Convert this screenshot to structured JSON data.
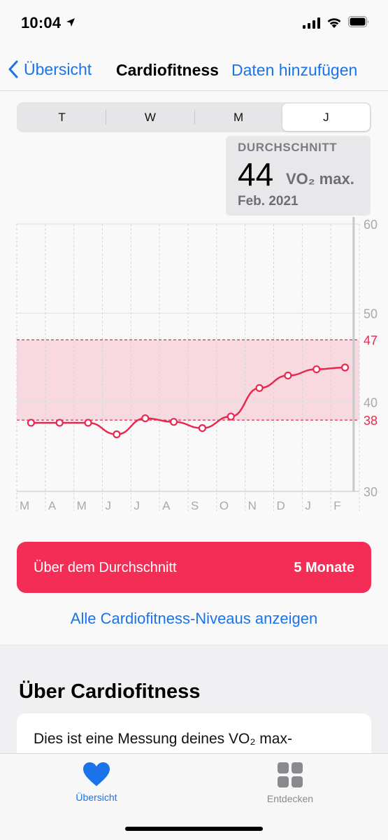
{
  "status_bar": {
    "time": "10:04"
  },
  "nav": {
    "back_label": "Übersicht",
    "title": "Cardiofitness",
    "action_label": "Daten hinzufügen"
  },
  "segments": [
    {
      "label": "T",
      "active": false
    },
    {
      "label": "W",
      "active": false
    },
    {
      "label": "M",
      "active": false
    },
    {
      "label": "J",
      "active": true
    }
  ],
  "summary": {
    "label": "DURCHSCHNITT",
    "value": "44",
    "unit": "VO₂ max.",
    "date": "Feb. 2021"
  },
  "chart_data": {
    "type": "line",
    "categories": [
      "M",
      "A",
      "M",
      "J",
      "J",
      "A",
      "S",
      "O",
      "N",
      "D",
      "J",
      "F"
    ],
    "x": [
      "Mär",
      "Apr",
      "Mai",
      "Jun",
      "Jul",
      "Aug",
      "Sep",
      "Okt",
      "Nov",
      "Dez",
      "Jan",
      "Feb"
    ],
    "series": [
      {
        "color": "#e8294f",
        "values": [
          37.7,
          37.7,
          37.7,
          36.4,
          38.2,
          37.8,
          37.1,
          38.4,
          41.6,
          43.0,
          43.7,
          43.9
        ]
      }
    ],
    "ylim": [
      30,
      60
    ],
    "yticks": [
      30,
      40,
      50,
      60
    ],
    "range_band": {
      "low": 38,
      "high": 47,
      "color": "#f7d9df"
    },
    "band_labels": [
      "47",
      "38"
    ],
    "highlight_category": "F",
    "grid": true,
    "axis_color": "#a9a9ad"
  },
  "banner": {
    "label": "Über dem Durchschnitt",
    "value": "5 Monate",
    "color": "#f32d55"
  },
  "levels_link": "Alle Cardiofitness-Niveaus anzeigen",
  "section": {
    "title": "Über Cardiofitness",
    "text": "Dies ist eine Messung deines VO₂ max-"
  },
  "tabbar": {
    "tabs": [
      {
        "label": "Übersicht",
        "icon": "heart-icon",
        "active": true
      },
      {
        "label": "Entdecken",
        "icon": "grid-icon",
        "active": false
      }
    ]
  },
  "colors": {
    "accent": "#1a73e8",
    "brand": "#f32d55"
  }
}
